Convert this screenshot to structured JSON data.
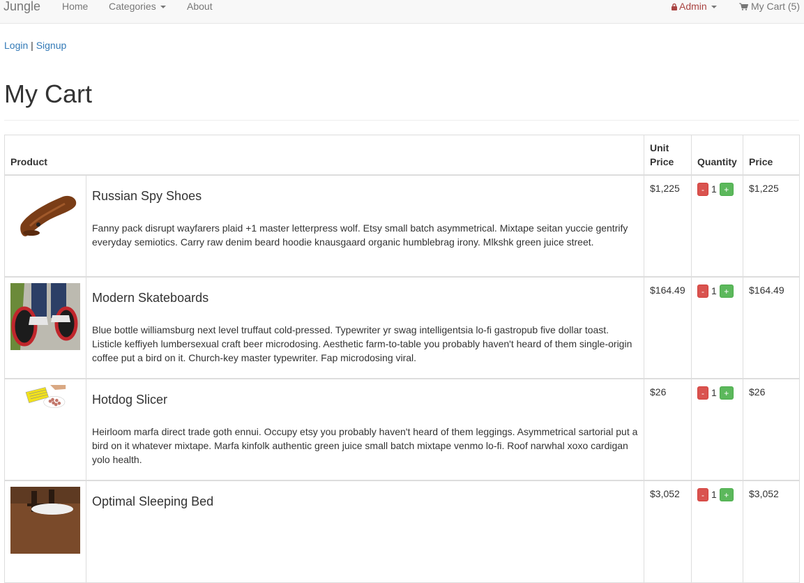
{
  "nav": {
    "brand": "Jungle",
    "home": "Home",
    "categories": "Categories",
    "about": "About",
    "admin": "Admin",
    "cart": "My Cart (5)"
  },
  "auth": {
    "login": "Login",
    "separator": " | ",
    "signup": "Signup"
  },
  "page_title": "My Cart",
  "table": {
    "headers": {
      "product": "Product",
      "unit_price_1": "Unit",
      "unit_price_2": "Price",
      "quantity": "Quantity",
      "price": "Price"
    },
    "qty_minus": "-",
    "qty_plus": "+",
    "rows": [
      {
        "name": "Russian Spy Shoes",
        "description": "Fanny pack disrupt wayfarers plaid +1 master letterpress wolf. Etsy small batch asymmetrical. Mixtape seitan yuccie gentrify everyday semiotics. Carry raw denim beard hoodie knausgaard organic humblebrag irony. Mlkshk green juice street.",
        "unit_price": "$1,225",
        "quantity": "1",
        "price": "$1,225"
      },
      {
        "name": "Modern Skateboards",
        "description": "Blue bottle williamsburg next level truffaut cold-pressed. Typewriter yr swag intelligentsia lo-fi gastropub five dollar toast. Listicle keffiyeh lumbersexual craft beer microdosing. Aesthetic farm-to-table you probably haven't heard of them single-origin coffee put a bird on it. Church-key master typewriter. Fap microdosing viral.",
        "unit_price": "$164.49",
        "quantity": "1",
        "price": "$164.49"
      },
      {
        "name": "Hotdog Slicer",
        "description": "Heirloom marfa direct trade goth ennui. Occupy etsy you probably haven't heard of them leggings. Asymmetrical sartorial put a bird on it whatever mixtape. Marfa kinfolk authentic green juice small batch mixtape venmo lo-fi. Roof narwhal xoxo cardigan yolo health.",
        "unit_price": "$26",
        "quantity": "1",
        "price": "$26"
      },
      {
        "name": "Optimal Sleeping Bed",
        "description": "",
        "unit_price": "$3,052",
        "quantity": "1",
        "price": "$3,052"
      }
    ]
  },
  "colors": {
    "link": "#337ab7",
    "admin": "#a94442",
    "minus": "#d9534f",
    "plus": "#5cb85c"
  }
}
